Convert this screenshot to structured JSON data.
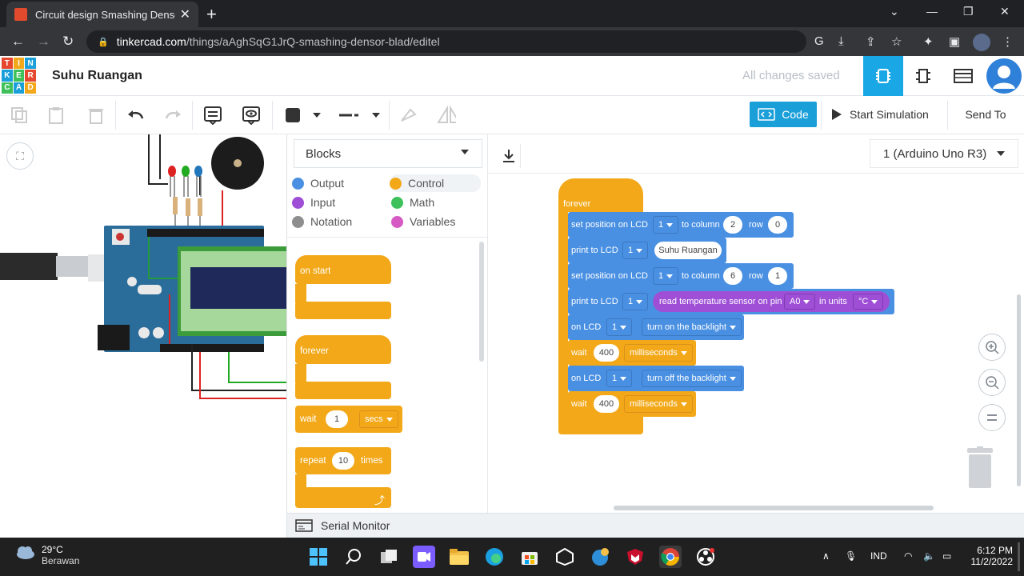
{
  "browser": {
    "tab_title": "Circuit design Smashing Densor-",
    "url_domain": "tinkercad.com",
    "url_path": "/things/aAghSqG1JrQ-smashing-densor-blad/editel"
  },
  "header": {
    "logo_letters": [
      "TIN",
      "KER",
      "CAD"
    ],
    "project_title": "Suhu Ruangan",
    "save_status": "All changes saved"
  },
  "toolbar": {
    "code_label": "Code",
    "start_simulation_label": "Start Simulation",
    "send_to_label": "Send To"
  },
  "editor": {
    "mode_select": "Blocks",
    "device_select": "1 (Arduino Uno R3)",
    "categories": [
      {
        "label": "Output",
        "color": "#4a90e2"
      },
      {
        "label": "Control",
        "color": "#f2a818"
      },
      {
        "label": "Input",
        "color": "#9e4fd6"
      },
      {
        "label": "Math",
        "color": "#3ec15a"
      },
      {
        "label": "Notation",
        "color": "#8e8e8e"
      },
      {
        "label": "Variables",
        "color": "#d65ac3"
      }
    ],
    "palette": {
      "on_start": "on start",
      "forever": "forever",
      "wait": "wait",
      "wait_value": "1",
      "wait_unit": "secs",
      "repeat": "repeat",
      "repeat_value": "10",
      "repeat_unit": "times"
    },
    "program": {
      "hat": "forever",
      "set_position": "set position on LCD",
      "to_column": "to column",
      "row": "row",
      "print": "print to LCD",
      "on_lcd": "on LCD",
      "wait": "wait",
      "lcd_id": "1",
      "col1": "2",
      "row1": "0",
      "text1": "Suhu Ruangan",
      "col2": "6",
      "row2": "1",
      "read_temp": "read temperature sensor on pin",
      "pin": "A0",
      "in_units": "in units",
      "unit": "°C",
      "backlight_on": "turn on the backlight",
      "backlight_off": "turn off the backlight",
      "ms_value": "400",
      "ms_unit": "milliseconds"
    },
    "serial_monitor": "Serial Monitor"
  },
  "taskbar": {
    "temp": "29°C",
    "condition": "Berawan",
    "lang": "IND",
    "time": "6:12 PM",
    "date": "11/2/2022"
  }
}
